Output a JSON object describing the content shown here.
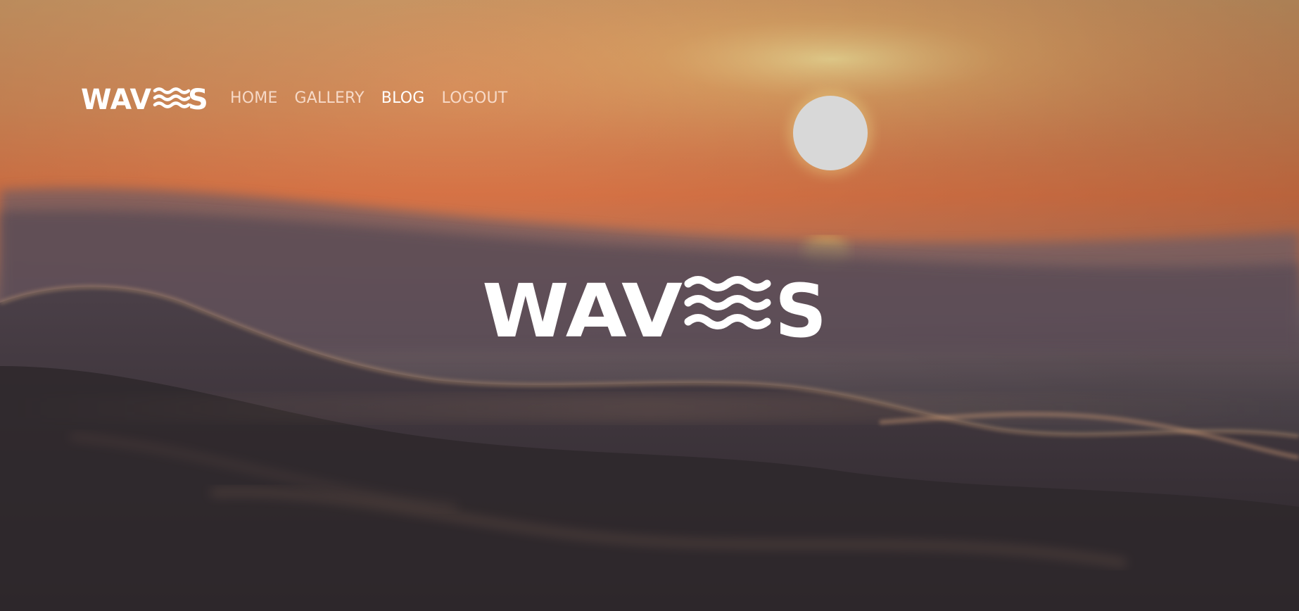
{
  "brand": {
    "logo_text": "WAVES",
    "logo_color": "#ffffff"
  },
  "nav": {
    "items": [
      {
        "label": "HOME",
        "active": false
      },
      {
        "label": "GALLERY",
        "active": false
      },
      {
        "label": "BLOG",
        "active": true
      },
      {
        "label": "LOGOUT",
        "active": false
      }
    ]
  },
  "hero": {
    "logo_text": "WAVES",
    "background": "ocean-sunset-photo",
    "colors": {
      "sky_top": "#d29a64",
      "sky_horizon": "#e27848",
      "sun": "#d8d8d8",
      "sea_dark": "#3a3436"
    }
  }
}
